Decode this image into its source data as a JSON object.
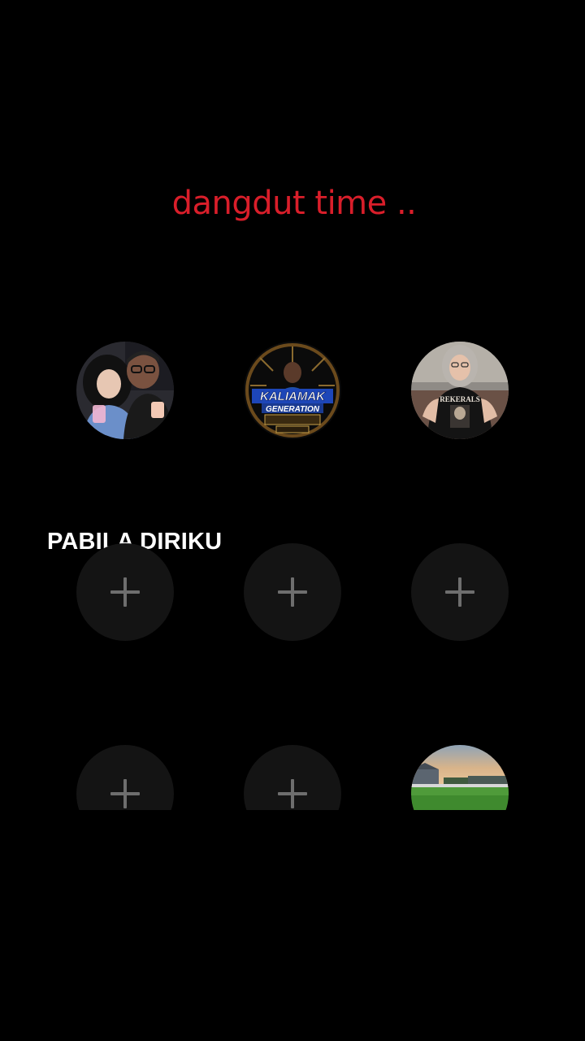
{
  "caption": "dangdut time ..",
  "section_title": "PABILA DIRIKU",
  "colors": {
    "background": "#000000",
    "caption": "#d91e2a",
    "section_title": "#ffffff",
    "empty_slot": "#141414",
    "plus": "#6e6e6e"
  },
  "rows": [
    {
      "slots": [
        {
          "kind": "avatar",
          "icon": "couple-photo-avatar"
        },
        {
          "kind": "avatar",
          "icon": "kaliamak-generation-logo",
          "logo_text": [
            "KALIAMAK",
            "GENERATION"
          ]
        },
        {
          "kind": "avatar",
          "icon": "woman-hijab-photo-avatar",
          "shirt_text": "REKERALS"
        }
      ]
    },
    {
      "slots": [
        {
          "kind": "empty",
          "icon": "plus-icon"
        },
        {
          "kind": "empty",
          "icon": "plus-icon"
        },
        {
          "kind": "empty",
          "icon": "plus-icon"
        }
      ]
    },
    {
      "slots": [
        {
          "kind": "empty",
          "icon": "plus-icon"
        },
        {
          "kind": "empty",
          "icon": "plus-icon"
        },
        {
          "kind": "avatar",
          "icon": "landscape-photo-avatar"
        }
      ]
    }
  ]
}
